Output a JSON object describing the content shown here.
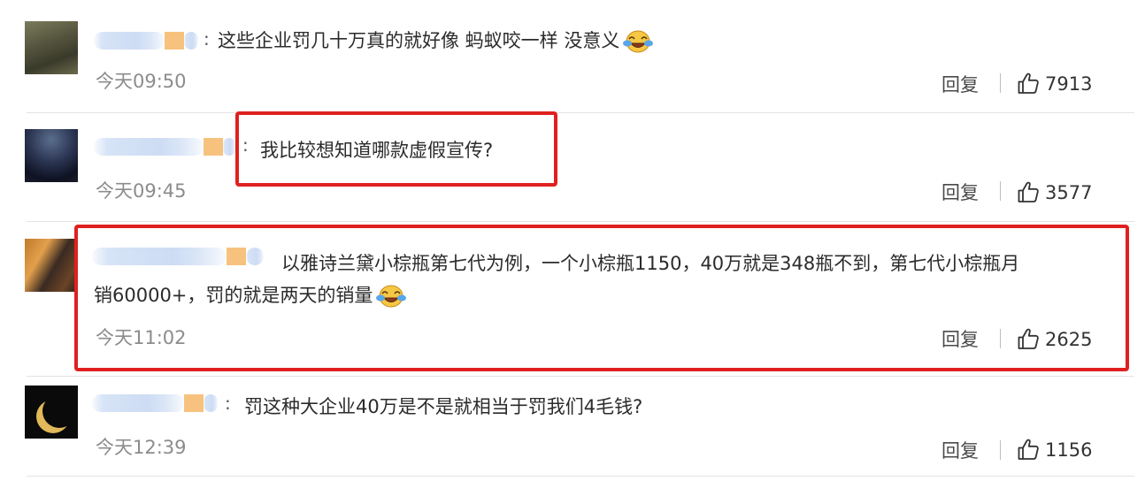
{
  "actions": {
    "reply_label": "回复"
  },
  "comments": [
    {
      "text": "这些企业罚几十万真的就好像 蚂蚁咬一样 没意义",
      "emoji": "laughing-crying-emoji",
      "time": "今天09:50",
      "likes": "7913"
    },
    {
      "text": "我比较想知道哪款虚假宣传?",
      "time": "今天09:45",
      "likes": "3577"
    },
    {
      "text_line1": "以雅诗兰黛小棕瓶第七代为例，一个小棕瓶1150，40万就是348瓶不到，第七代小棕瓶月",
      "text_line2": "销60000+，罚的就是两天的销量",
      "emoji": "laughing-crying-emoji",
      "time": "今天11:02",
      "likes": "2625"
    },
    {
      "text": "罚这种大企业40万是不是就相当于罚我们4毛钱?",
      "time": "今天12:39",
      "likes": "1156"
    }
  ],
  "colors": {
    "highlight_border": "#e02020",
    "timestamp": "#8c8c8c",
    "divider": "#e3e3e3"
  },
  "icons": {
    "like": "thumbs-up-icon",
    "emoji": "laughing-crying-emoji"
  }
}
